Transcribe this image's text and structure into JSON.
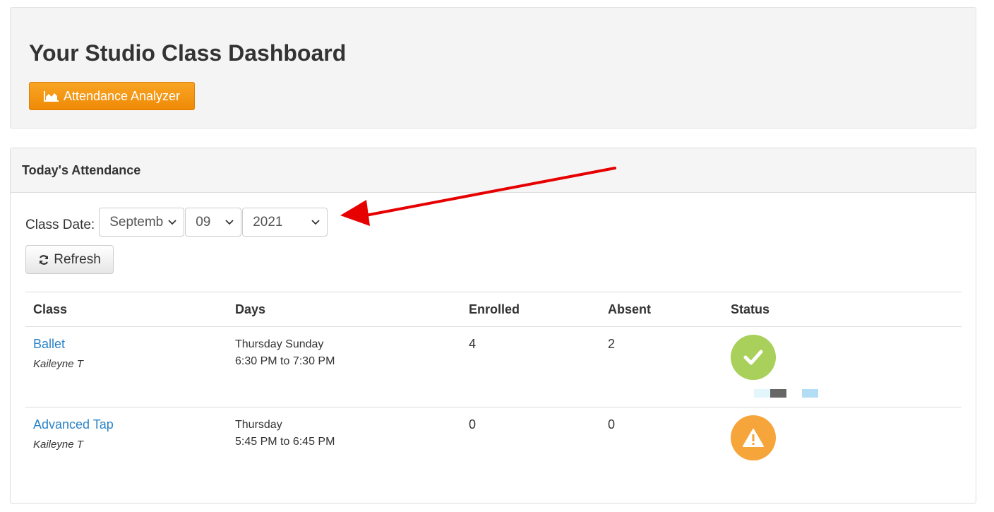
{
  "header": {
    "title": "Your Studio Class Dashboard",
    "analyzer_button": "Attendance Analyzer"
  },
  "panel": {
    "title": "Today's Attendance",
    "date_label": "Class Date:",
    "month_value": "Septemb",
    "day_value": "09",
    "year_value": "2021",
    "refresh_button": "Refresh"
  },
  "table": {
    "headers": [
      "Class",
      "Days",
      "Enrolled",
      "Absent",
      "Status"
    ],
    "rows": [
      {
        "class": "Ballet",
        "instructor": "Kaileyne T",
        "days": "Thursday Sunday",
        "time": "6:30 PM to 7:30 PM",
        "enrolled": "4",
        "absent": "2",
        "status": "check-icon"
      },
      {
        "class": "Advanced Tap",
        "instructor": "Kaileyne T",
        "days": "Thursday",
        "time": "5:45 PM to 6:45 PM",
        "enrolled": "0",
        "absent": "0",
        "status": "warning-icon"
      }
    ]
  },
  "colors": {
    "accent_orange": "#ef8a06",
    "link_blue": "#2a83c6",
    "status_ok": "#a8d05a",
    "status_warn": "#f6a53a",
    "annotation_red": "#e60000"
  }
}
